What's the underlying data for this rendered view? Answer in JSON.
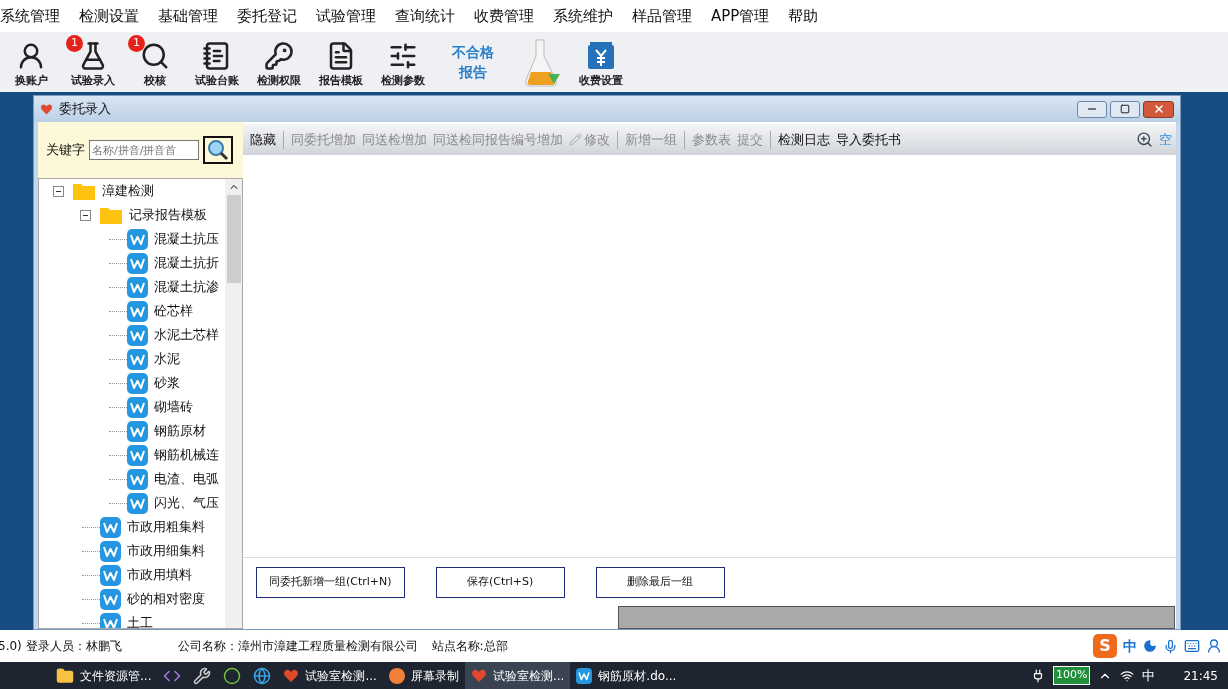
{
  "menu": [
    "系统管理",
    "检测设置",
    "基础管理",
    "委托登记",
    "试验管理",
    "查询统计",
    "收费管理",
    "系统维护",
    "样品管理",
    "APP管理",
    "帮助"
  ],
  "toolbar": [
    {
      "kind": "icon",
      "label": "换账户"
    },
    {
      "kind": "icon",
      "label": "试验录入",
      "badge": "1"
    },
    {
      "kind": "icon",
      "label": "校核",
      "badge": "1"
    },
    {
      "kind": "icon",
      "label": "试验台账"
    },
    {
      "kind": "icon",
      "label": "检测权限"
    },
    {
      "kind": "icon",
      "label": "报告模板"
    },
    {
      "kind": "icon",
      "label": "检测参数"
    },
    {
      "kind": "text",
      "label": "不合格报告"
    },
    {
      "kind": "picture"
    },
    {
      "kind": "icon",
      "label": "收费设置"
    }
  ],
  "window": {
    "title": "委托录入",
    "search": {
      "label": "关键字",
      "placeholder": "名称/拼音/拼音首"
    },
    "tree": [
      {
        "label": "漳建检测",
        "kind": "folder",
        "expanded": true,
        "children": [
          {
            "label": "记录报告模板",
            "kind": "folder",
            "expanded": true,
            "children": [
              {
                "label": "混凝土抗压",
                "kind": "doc"
              },
              {
                "label": "混凝土抗折",
                "kind": "doc"
              },
              {
                "label": "混凝土抗渗",
                "kind": "doc"
              },
              {
                "label": "砼芯样",
                "kind": "doc"
              },
              {
                "label": "水泥土芯样",
                "kind": "doc"
              },
              {
                "label": "水泥",
                "kind": "doc"
              },
              {
                "label": "砂浆",
                "kind": "doc"
              },
              {
                "label": "砌墙砖",
                "kind": "doc"
              },
              {
                "label": "钢筋原材",
                "kind": "doc"
              },
              {
                "label": "钢筋机械连",
                "kind": "doc"
              },
              {
                "label": "电渣、电弧",
                "kind": "doc"
              },
              {
                "label": "闪光、气压",
                "kind": "doc"
              }
            ]
          },
          {
            "label": "市政用粗集料",
            "kind": "doc"
          },
          {
            "label": "市政用细集料",
            "kind": "doc"
          },
          {
            "label": "市政用填料",
            "kind": "doc"
          },
          {
            "label": "砂的相对密度",
            "kind": "doc"
          },
          {
            "label": "土工",
            "kind": "doc"
          }
        ]
      }
    ],
    "actions": [
      {
        "kind": "text",
        "label": "隐藏",
        "disabled": false
      },
      {
        "kind": "separator"
      },
      {
        "kind": "text",
        "label": "同委托增加",
        "disabled": true
      },
      {
        "kind": "text",
        "label": "同送检增加",
        "disabled": true
      },
      {
        "kind": "text",
        "label": "同送检同报告编号增加",
        "disabled": true
      },
      {
        "kind": "edit",
        "label": "修改",
        "disabled": true
      },
      {
        "kind": "separator"
      },
      {
        "kind": "text",
        "label": "新增一组",
        "disabled": true
      },
      {
        "kind": "separator"
      },
      {
        "kind": "text",
        "label": "参数表",
        "disabled": true
      },
      {
        "kind": "text",
        "label": "提交",
        "disabled": true
      },
      {
        "kind": "separator"
      },
      {
        "kind": "text",
        "label": "检测日志",
        "disabled": false
      },
      {
        "kind": "text",
        "label": "导入委托书",
        "disabled": false
      }
    ],
    "corner_label": "空",
    "buttons": [
      "同委托新增一组(Ctrl+N)",
      "保存(Ctrl+S)",
      "删除最后一组"
    ]
  },
  "status_bar": {
    "login": "5.0) 登录人员：林鹏飞",
    "company": "公司名称：漳州市漳建工程质量检测有限公司",
    "site": "站点名称:总部",
    "ime_logo": "S",
    "ime": "中"
  },
  "taskbar": {
    "apps": [
      {
        "label": "文件资源管...",
        "kind": "folder",
        "selected": false
      },
      {
        "kind": "vs",
        "selected": false
      },
      {
        "kind": "tool",
        "selected": false
      },
      {
        "kind": "ie",
        "selected": false
      },
      {
        "kind": "edge",
        "selected": false
      },
      {
        "label": "试验室检测...",
        "kind": "heart",
        "selected": false
      },
      {
        "label": "屏幕录制",
        "kind": "record",
        "selected": false
      },
      {
        "label": "试验室检测...",
        "kind": "heart",
        "selected": true
      },
      {
        "label": "钢筋原材.do...",
        "kind": "word",
        "selected": false
      }
    ],
    "battery": "100%",
    "ime": "中",
    "time": "21:45"
  }
}
